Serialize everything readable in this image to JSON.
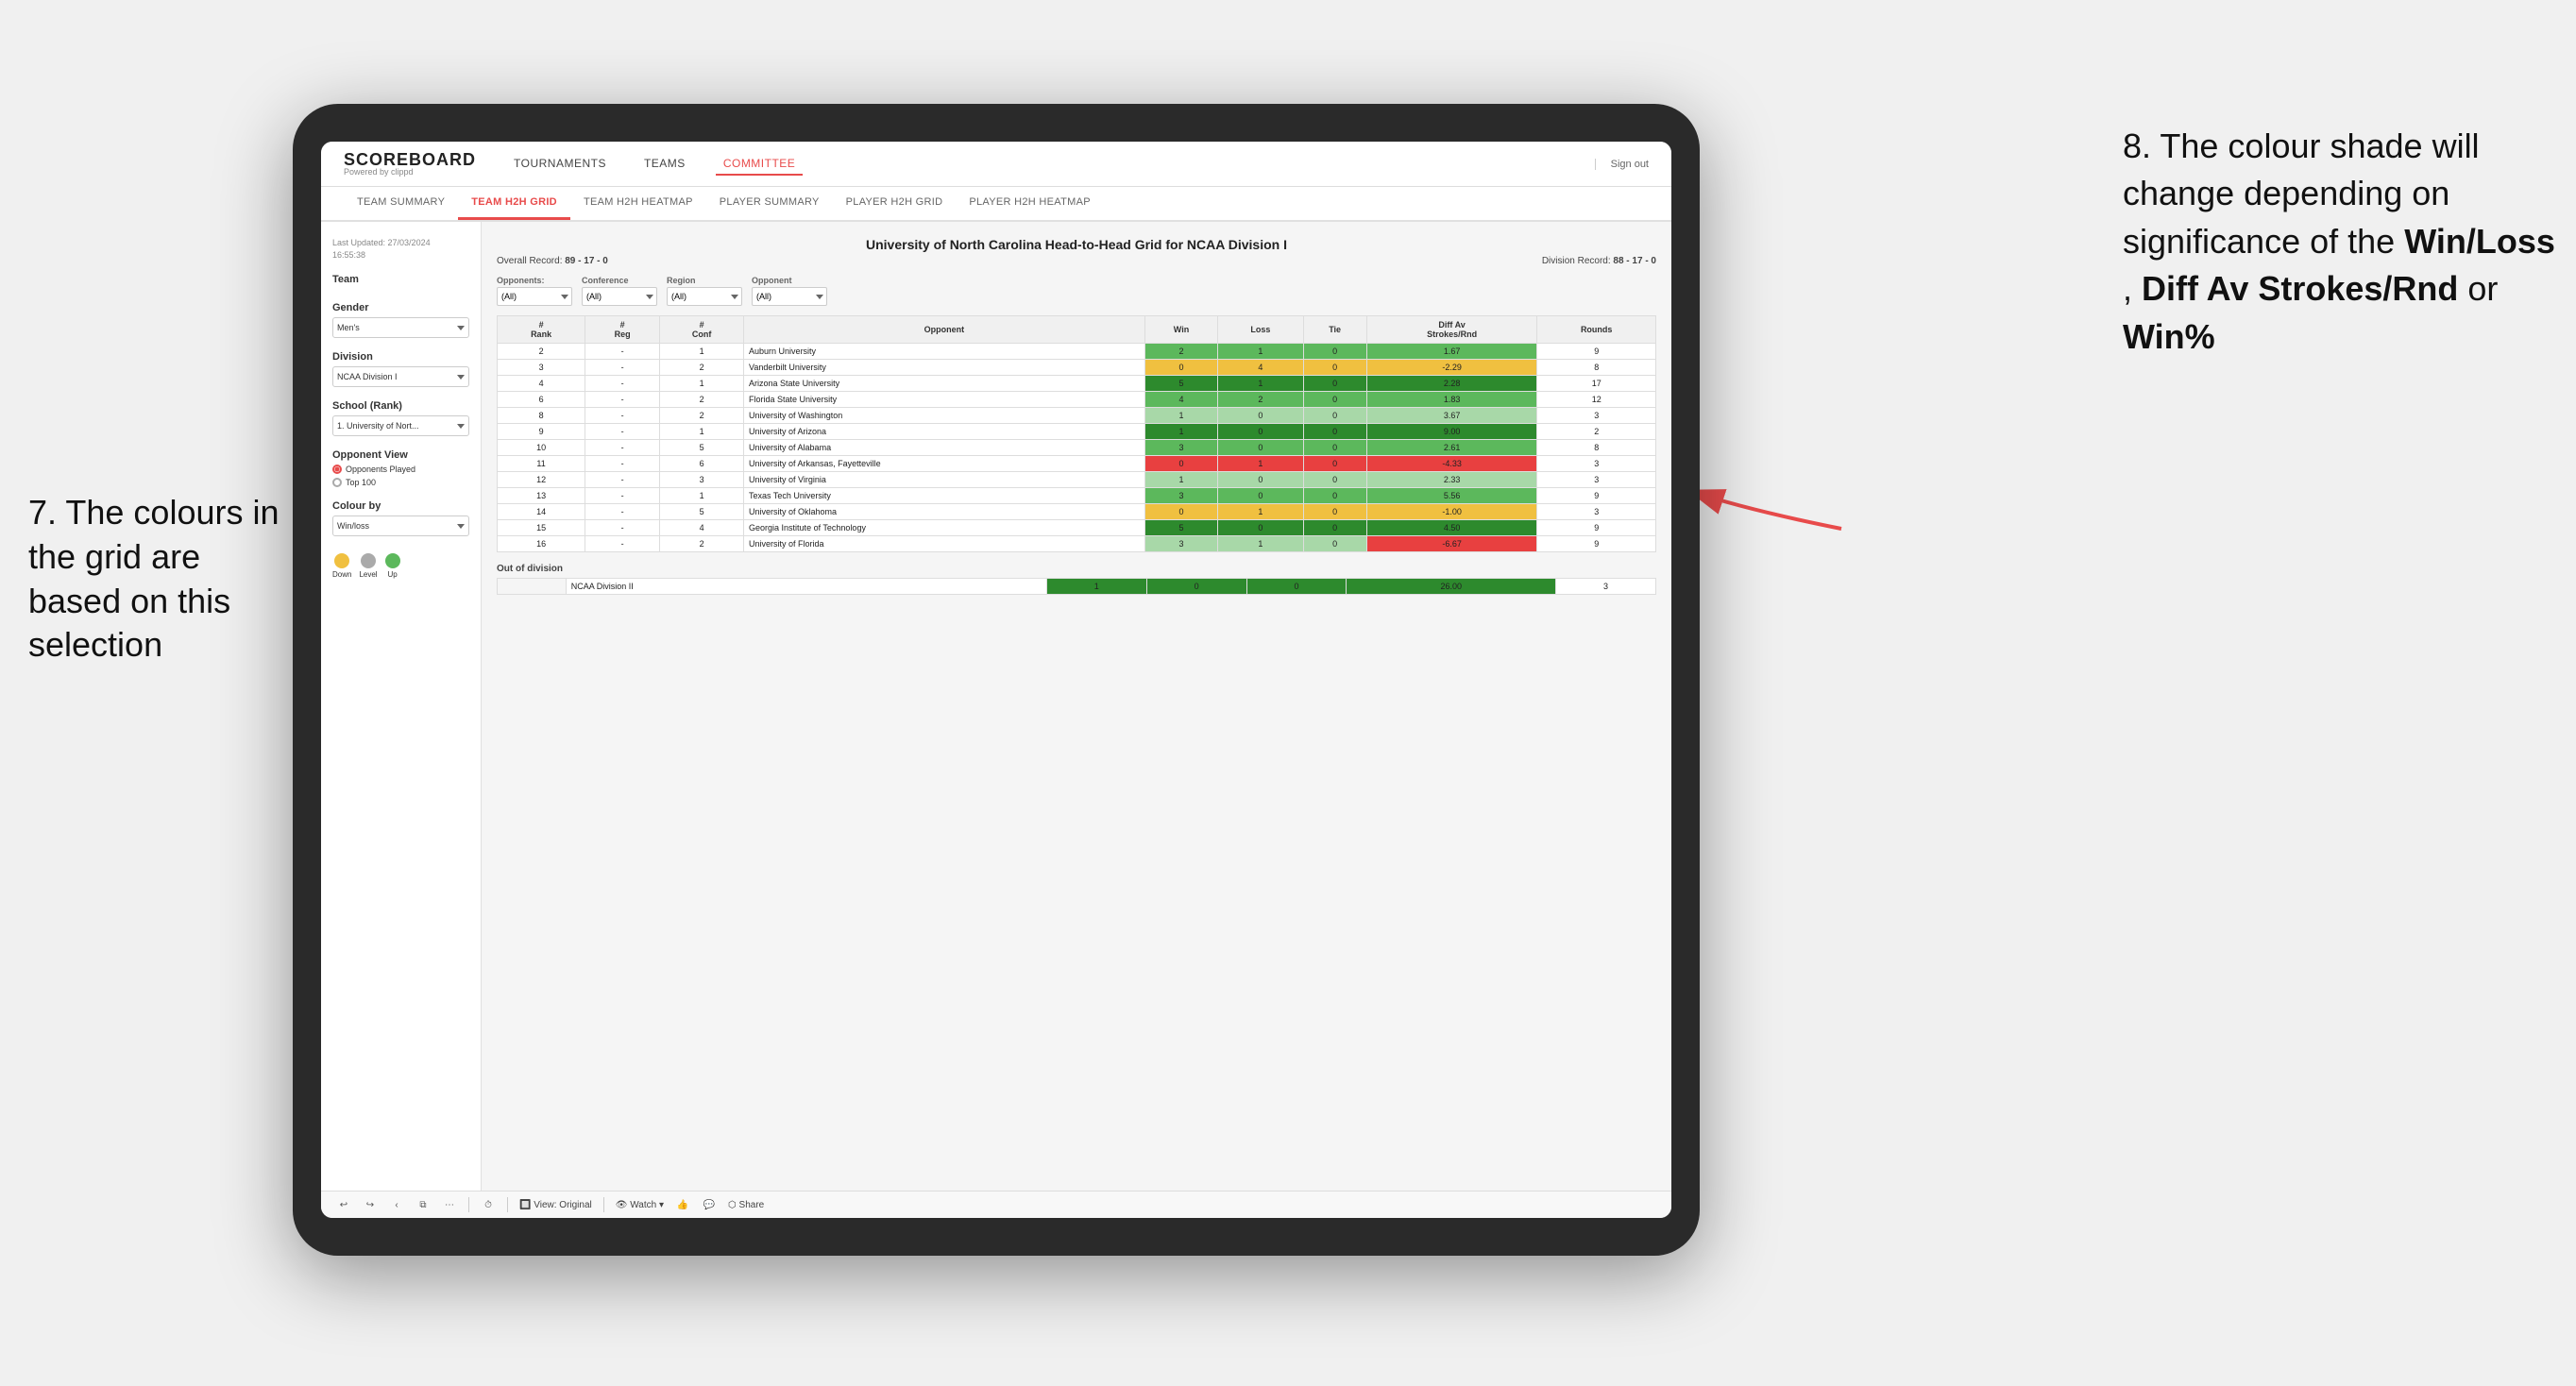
{
  "annotations": {
    "left": {
      "number": "7.",
      "text": "The colours in the grid are based on this selection"
    },
    "right": {
      "number": "8.",
      "text": "The colour shade will change depending on significance of the ",
      "bold1": "Win/Loss",
      "text2": ", ",
      "bold2": "Diff Av Strokes/Rnd",
      "text3": " or ",
      "bold3": "Win%"
    }
  },
  "nav": {
    "logo_main": "SCOREBOARD",
    "logo_sub": "Powered by clippd",
    "links": [
      "TOURNAMENTS",
      "TEAMS",
      "COMMITTEE"
    ],
    "active_link": "COMMITTEE",
    "sign_out": "Sign out"
  },
  "sub_nav": {
    "items": [
      "TEAM SUMMARY",
      "TEAM H2H GRID",
      "TEAM H2H HEATMAP",
      "PLAYER SUMMARY",
      "PLAYER H2H GRID",
      "PLAYER H2H HEATMAP"
    ],
    "active": "TEAM H2H GRID"
  },
  "left_panel": {
    "last_updated_label": "Last Updated: 27/03/2024",
    "last_updated_time": "16:55:38",
    "team_label": "Team",
    "gender_label": "Gender",
    "gender_value": "Men's",
    "division_label": "Division",
    "division_value": "NCAA Division I",
    "school_label": "School (Rank)",
    "school_value": "1. University of Nort...",
    "opponent_view_label": "Opponent View",
    "radio_options": [
      "Opponents Played",
      "Top 100"
    ],
    "radio_selected": "Opponents Played",
    "colour_by_label": "Colour by",
    "colour_by_value": "Win/loss",
    "legend": [
      {
        "label": "Down",
        "color": "#f0c040"
      },
      {
        "label": "Level",
        "color": "#aaaaaa"
      },
      {
        "label": "Up",
        "color": "#5cb85c"
      }
    ]
  },
  "grid": {
    "title": "University of North Carolina Head-to-Head Grid for NCAA Division I",
    "overall_record": "89 - 17 - 0",
    "division_record": "88 - 17 - 0",
    "filters": {
      "opponents_label": "Opponents:",
      "opponents_value": "(All)",
      "conference_label": "Conference",
      "conference_value": "(All)",
      "region_label": "Region",
      "region_value": "(All)",
      "opponent_label": "Opponent",
      "opponent_value": "(All)"
    },
    "columns": [
      "#\nRank",
      "#\nReg",
      "#\nConf",
      "Opponent",
      "Win",
      "Loss",
      "Tie",
      "Diff Av\nStrokes/Rnd",
      "Rounds"
    ],
    "rows": [
      {
        "rank": "2",
        "reg": "-",
        "conf": "1",
        "opponent": "Auburn University",
        "win": "2",
        "loss": "1",
        "tie": "0",
        "diff": "1.67",
        "rounds": "9",
        "win_color": "cell-green-med",
        "diff_color": "cell-green-med"
      },
      {
        "rank": "3",
        "reg": "-",
        "conf": "2",
        "opponent": "Vanderbilt University",
        "win": "0",
        "loss": "4",
        "tie": "0",
        "diff": "-2.29",
        "rounds": "8",
        "win_color": "cell-yellow",
        "diff_color": "cell-yellow"
      },
      {
        "rank": "4",
        "reg": "-",
        "conf": "1",
        "opponent": "Arizona State University",
        "win": "5",
        "loss": "1",
        "tie": "0",
        "diff": "2.28",
        "rounds": "17",
        "win_color": "cell-green-dark",
        "diff_color": "cell-green-dark"
      },
      {
        "rank": "6",
        "reg": "-",
        "conf": "2",
        "opponent": "Florida State University",
        "win": "4",
        "loss": "2",
        "tie": "0",
        "diff": "1.83",
        "rounds": "12",
        "win_color": "cell-green-med",
        "diff_color": "cell-green-med"
      },
      {
        "rank": "8",
        "reg": "-",
        "conf": "2",
        "opponent": "University of Washington",
        "win": "1",
        "loss": "0",
        "tie": "0",
        "diff": "3.67",
        "rounds": "3",
        "win_color": "cell-green-light",
        "diff_color": "cell-green-light"
      },
      {
        "rank": "9",
        "reg": "-",
        "conf": "1",
        "opponent": "University of Arizona",
        "win": "1",
        "loss": "0",
        "tie": "0",
        "diff": "9.00",
        "rounds": "2",
        "win_color": "cell-green-dark",
        "diff_color": "cell-green-dark"
      },
      {
        "rank": "10",
        "reg": "-",
        "conf": "5",
        "opponent": "University of Alabama",
        "win": "3",
        "loss": "0",
        "tie": "0",
        "diff": "2.61",
        "rounds": "8",
        "win_color": "cell-green-med",
        "diff_color": "cell-green-med"
      },
      {
        "rank": "11",
        "reg": "-",
        "conf": "6",
        "opponent": "University of Arkansas, Fayetteville",
        "win": "0",
        "loss": "1",
        "tie": "0",
        "diff": "-4.33",
        "rounds": "3",
        "win_color": "cell-red",
        "diff_color": "cell-red"
      },
      {
        "rank": "12",
        "reg": "-",
        "conf": "3",
        "opponent": "University of Virginia",
        "win": "1",
        "loss": "0",
        "tie": "0",
        "diff": "2.33",
        "rounds": "3",
        "win_color": "cell-green-light",
        "diff_color": "cell-green-light"
      },
      {
        "rank": "13",
        "reg": "-",
        "conf": "1",
        "opponent": "Texas Tech University",
        "win": "3",
        "loss": "0",
        "tie": "0",
        "diff": "5.56",
        "rounds": "9",
        "win_color": "cell-green-med",
        "diff_color": "cell-green-med"
      },
      {
        "rank": "14",
        "reg": "-",
        "conf": "5",
        "opponent": "University of Oklahoma",
        "win": "0",
        "loss": "1",
        "tie": "0",
        "diff": "-1.00",
        "rounds": "3",
        "win_color": "cell-yellow",
        "diff_color": "cell-yellow"
      },
      {
        "rank": "15",
        "reg": "-",
        "conf": "4",
        "opponent": "Georgia Institute of Technology",
        "win": "5",
        "loss": "0",
        "tie": "0",
        "diff": "4.50",
        "rounds": "9",
        "win_color": "cell-green-dark",
        "diff_color": "cell-green-dark"
      },
      {
        "rank": "16",
        "reg": "-",
        "conf": "2",
        "opponent": "University of Florida",
        "win": "3",
        "loss": "1",
        "tie": "0",
        "diff": "-6.67",
        "rounds": "9",
        "win_color": "cell-green-light",
        "diff_color": "cell-red"
      }
    ],
    "out_of_division": {
      "title": "Out of division",
      "rows": [
        {
          "division": "NCAA Division II",
          "win": "1",
          "loss": "0",
          "tie": "0",
          "diff": "26.00",
          "rounds": "3",
          "win_color": "cell-green-dark",
          "diff_color": "cell-green-dark"
        }
      ]
    }
  },
  "bottom_toolbar": {
    "view_label": "View: Original",
    "watch_label": "Watch",
    "share_label": "Share"
  }
}
